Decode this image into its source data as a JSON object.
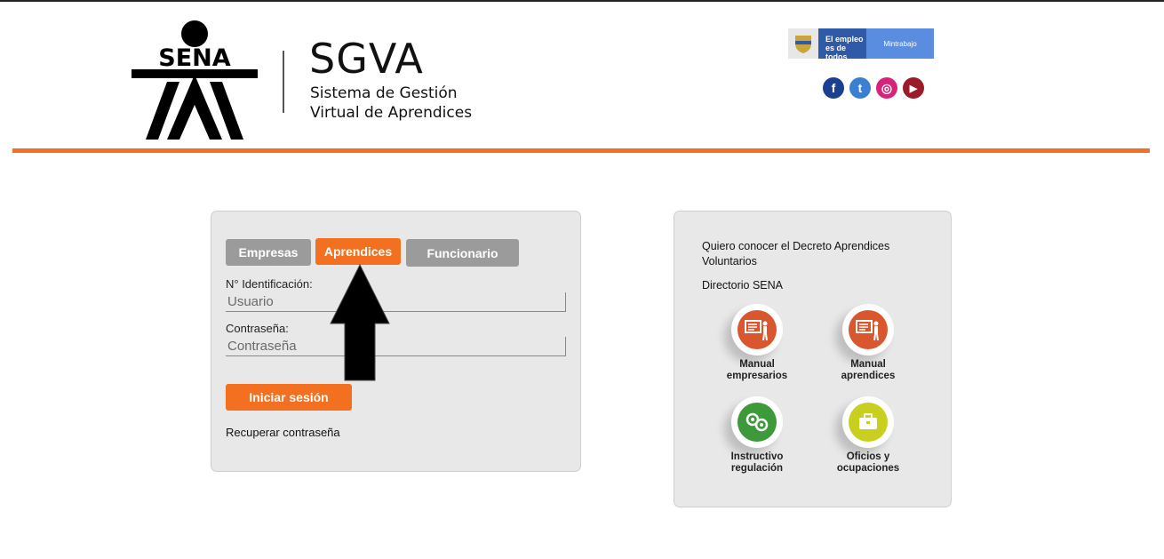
{
  "header": {
    "logo_text": "SENA",
    "app_title": "SGVA",
    "subtitle_line1": "Sistema de Gestión",
    "subtitle_line2": "Virtual de Aprendices",
    "gov_banner": {
      "line1": "El empleo",
      "line2": "es de todos",
      "ministry": "Mintrabajo"
    },
    "social": [
      {
        "name": "facebook",
        "glyph": "f",
        "color": "#1d3f8f"
      },
      {
        "name": "twitter",
        "glyph": "t",
        "color": "#3b7fd0"
      },
      {
        "name": "instagram",
        "glyph": "◎",
        "color": "#d6247a"
      },
      {
        "name": "youtube",
        "glyph": "▶",
        "color": "#9b1b2b"
      }
    ],
    "accent_color": "#f2701f"
  },
  "login": {
    "tabs": [
      {
        "label": "Empresas",
        "active": false
      },
      {
        "label": "Aprendices",
        "active": true
      },
      {
        "label": "Funcionario",
        "active": false
      }
    ],
    "id_label": "N° Identificación:",
    "id_placeholder": "Usuario",
    "password_label": "Contraseña:",
    "password_placeholder": "Contraseña",
    "submit_label": "Iniciar sesión",
    "recover_label": "Recuperar contraseña"
  },
  "info": {
    "decree_link": "Quiero conocer el Decreto Aprendices Voluntarios",
    "directory_link": "Directorio SENA",
    "tiles": [
      {
        "line1": "Manual",
        "line2": "empresarios",
        "icon": "presentation-icon",
        "color": "#d9572f"
      },
      {
        "line1": "Manual",
        "line2": "aprendices",
        "icon": "presentation-icon",
        "color": "#d9572f"
      },
      {
        "line1": "Instructivo",
        "line2": "regulación",
        "icon": "gears-icon",
        "color": "#3d9a3a"
      },
      {
        "line1": "Oficios y",
        "line2": "ocupaciones",
        "icon": "briefcase-icon",
        "color": "#c9cf1e"
      }
    ]
  }
}
